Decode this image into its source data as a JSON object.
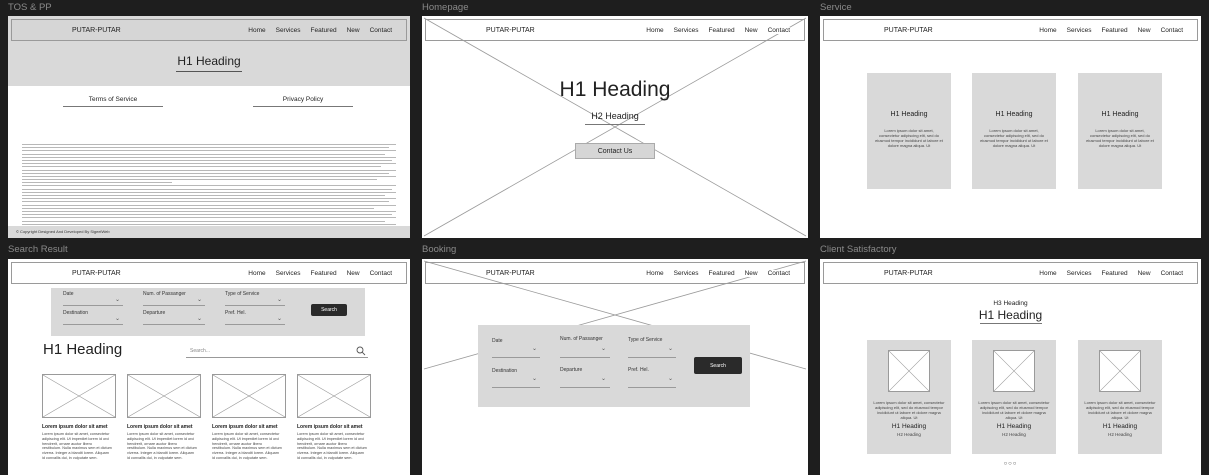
{
  "frames": {
    "tos": {
      "title": "TOS & PP"
    },
    "homepage": {
      "title": "Homepage"
    },
    "service": {
      "title": "Service"
    },
    "search": {
      "title": "Search Result"
    },
    "booking": {
      "title": "Booking"
    },
    "client": {
      "title": "Client Satisfactory"
    }
  },
  "nav": {
    "logo": "PUTAR-PUTAR",
    "links": [
      "Home",
      "Services",
      "Featured",
      "New",
      "Contact"
    ]
  },
  "tos": {
    "heading": "H1 Heading",
    "terms_label": "Terms of Service",
    "privacy_label": "Privacy Policy",
    "footer": "© Copyright Designed And Developed By SigeelWeb"
  },
  "homepage": {
    "h1": "H1 Heading",
    "h2": "H2 Heading",
    "cta": "Contact Us"
  },
  "service": {
    "cards": [
      {
        "heading": "H1 Heading",
        "text": "Lorem ipsum dolor sit amet, consectetur adipiscing elit, sed do eiusmod tempor incididunt ut labore et dolore magna aliqua. Ut"
      },
      {
        "heading": "H1 Heading",
        "text": "Lorem ipsum dolor sit amet, consectetur adipiscing elit, sed do eiusmod tempor incididunt ut labore et dolore magna aliqua. Ut"
      },
      {
        "heading": "H1 Heading",
        "text": "Lorem ipsum dolor sit amet, consectetur adipiscing elit, sed do eiusmod tempor incididunt ut labore et dolore magna aliqua. Ut"
      }
    ]
  },
  "search": {
    "labels": {
      "date": "Date",
      "passenger": "Num. of Passanger",
      "type": "Type of Service",
      "destination": "Destination",
      "departure": "Departure",
      "pref": "Pref. Hel."
    },
    "button": "Search",
    "heading": "H1 Heading",
    "search_placeholder": "Search...",
    "cards": [
      {
        "title": "Lorem ipsum dolor sit amet",
        "text": "Lorem ipsum dolor sit amet, consectetur adipiscing elit. Ut imperdiet lorem id orci hendrerit, ornare auctor libero vestibulum. Nulla maximus sem et dictum viverra. Integer a blandit lorem. Aliquam id convallis dui, in vulputate sem."
      },
      {
        "title": "Lorem ipsum dolor sit amet",
        "text": "Lorem ipsum dolor sit amet, consectetur adipiscing elit. Ut imperdiet lorem id orci hendrerit, ornare auctor libero vestibulum. Nulla maximus sem et dictum viverra. Integer a blandit lorem. Aliquam id convallis dui, in vulputate sem."
      },
      {
        "title": "Lorem ipsum dolor sit amet",
        "text": "Lorem ipsum dolor sit amet, consectetur adipiscing elit. Ut imperdiet lorem id orci hendrerit, ornare auctor libero vestibulum. Nulla maximus sem et dictum viverra. Integer a blandit lorem. Aliquam id convallis dui, in vulputate sem."
      },
      {
        "title": "Lorem ipsum dolor sit amet",
        "text": "Lorem ipsum dolor sit amet, consectetur adipiscing elit. Ut imperdiet lorem id orci hendrerit, ornare auctor libero vestibulum. Nulla maximus sem et dictum viverra. Integer a blandit lorem. Aliquam id convallis dui, in vulputate sem."
      }
    ]
  },
  "booking": {
    "labels": {
      "date": "Date",
      "passenger": "Num. of Passanger",
      "type": "Type of Service",
      "destination": "Destination",
      "departure": "Departure",
      "pref": "Pref. Hel."
    },
    "button": "Search"
  },
  "client": {
    "h3": "H3 Heading",
    "h1": "H1 Heading",
    "cards": [
      {
        "text": "Lorem ipsum dolor sit amet, consectetur adipiscing elit, sed do eiusmod tempor incididunt ut labore et dolore magna aliqua. Ut",
        "h1": "H1 Heading",
        "h2": "H2 Heading"
      },
      {
        "text": "Lorem ipsum dolor sit amet, consectetur adipiscing elit, sed do eiusmod tempor incididunt ut labore et dolore magna aliqua. Ut",
        "h1": "H1 Heading",
        "h2": "H2 Heading"
      },
      {
        "text": "Lorem ipsum dolor sit amet, consectetur adipiscing elit, sed do eiusmod tempor incididunt ut labore et dolore magna aliqua. Ut",
        "h1": "H1 Heading",
        "h2": "H2 Heading"
      }
    ],
    "dots": "○○○"
  },
  "colors": {
    "canvas": "#1e1e1e",
    "frame": "#ffffff",
    "placeholder_gray": "#d9d9d9",
    "button_dark": "#2a2a2a",
    "frame_title": "#8a8a8a"
  }
}
